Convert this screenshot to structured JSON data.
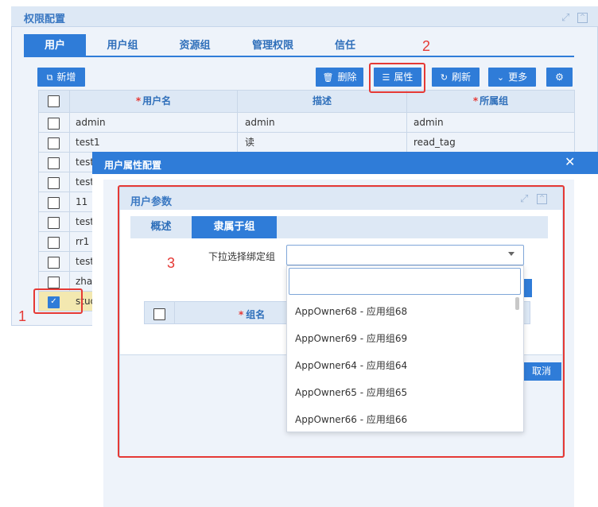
{
  "panel": {
    "title": "权限配置",
    "tabs": [
      "用户",
      "用户组",
      "资源组",
      "管理权限",
      "信任"
    ]
  },
  "toolbar": {
    "new_label": "新增",
    "delete_label": "删除",
    "props_label": "属性",
    "refresh_label": "刷新",
    "more_label": "更多"
  },
  "table": {
    "columns": [
      "用户名",
      "描述",
      "所属组"
    ],
    "rows": [
      {
        "name": "admin",
        "desc": "admin",
        "group": "admin"
      },
      {
        "name": "test1",
        "desc": "读",
        "group": "read_tag"
      },
      {
        "name": "test",
        "desc": "",
        "group": ""
      },
      {
        "name": "test",
        "desc": "",
        "group": ""
      },
      {
        "name": "11",
        "desc": "",
        "group": ""
      },
      {
        "name": "test",
        "desc": "",
        "group": ""
      },
      {
        "name": "rr1",
        "desc": "",
        "group": ""
      },
      {
        "name": "test",
        "desc": "",
        "group": ""
      },
      {
        "name": "zha",
        "desc": "",
        "group": ""
      },
      {
        "name": "stud",
        "desc": "",
        "group": ""
      }
    ]
  },
  "dialog": {
    "title": "用户属性配置",
    "inner_title": "用户参数",
    "tabs": [
      "概述",
      "隶属于组"
    ],
    "bind_label": "下拉选择绑定组",
    "sub_table_col": "组名",
    "cancel_label": "取消",
    "dropdown_items": [
      "AppOwner68 - 应用组68",
      "AppOwner69 - 应用组69",
      "AppOwner64 - 应用组64",
      "AppOwner65 - 应用组65",
      "AppOwner66 - 应用组66"
    ]
  },
  "annotations": [
    "1",
    "2",
    "3"
  ],
  "colors": {
    "primary": "#2f7cd8",
    "annotation": "#e53935",
    "header_bg": "#dde8f5"
  }
}
